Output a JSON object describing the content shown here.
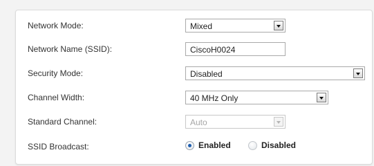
{
  "form": {
    "network_mode": {
      "label": "Network Mode:",
      "value": "Mixed"
    },
    "ssid": {
      "label": "Network Name (SSID):",
      "value": "CiscoH0024"
    },
    "security_mode": {
      "label": "Security Mode:",
      "value": "Disabled"
    },
    "channel_width": {
      "label": "Channel Width:",
      "value": "40 MHz Only"
    },
    "standard_channel": {
      "label": "Standard Channel:",
      "value": "Auto",
      "disabled": true
    },
    "ssid_broadcast": {
      "label": "SSID Broadcast:",
      "options": [
        "Enabled",
        "Disabled"
      ],
      "selected": "Enabled"
    }
  },
  "colors": {
    "radio_accent": "#1e5fb0"
  }
}
